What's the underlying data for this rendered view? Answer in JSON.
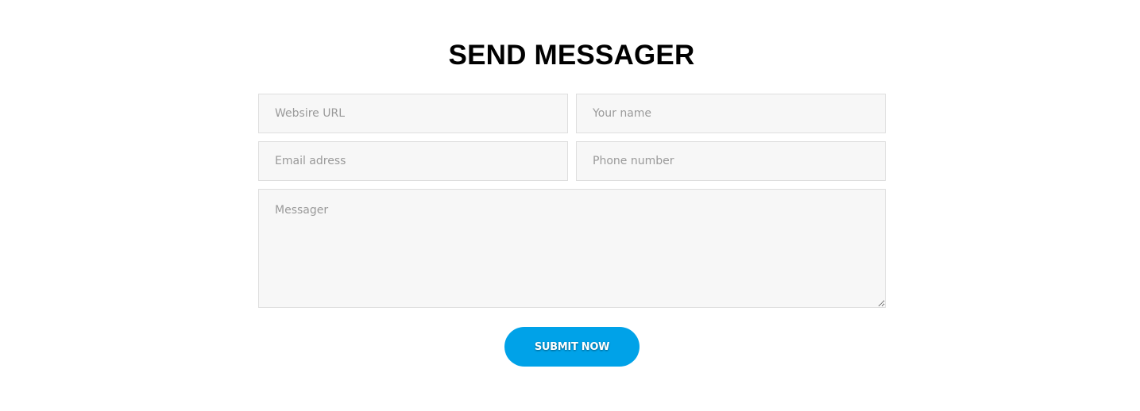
{
  "form": {
    "title": "SEND MESSAGER",
    "website_placeholder": "Websire URL",
    "name_placeholder": "Your name",
    "email_placeholder": "Email adress",
    "phone_placeholder": "Phone number",
    "message_placeholder": "Messager",
    "submit_label": "SUBMIT NOW"
  },
  "colors": {
    "accent": "#00a2e8",
    "field_background": "#f7f7f7",
    "field_border": "#dedede",
    "placeholder": "#9a9a9a"
  }
}
